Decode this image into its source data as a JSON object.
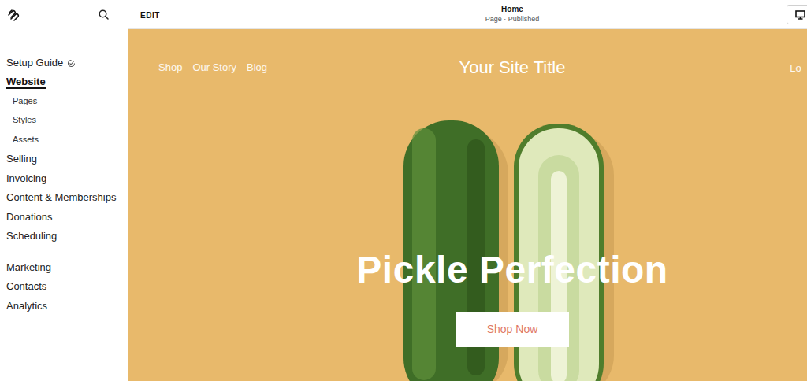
{
  "sidebar": {
    "groups": [
      {
        "items": [
          {
            "label": "Setup Guide",
            "kind": "section",
            "selected": false,
            "has_icon": true
          },
          {
            "label": "Website",
            "kind": "section",
            "selected": true,
            "has_icon": false
          },
          {
            "label": "Pages",
            "kind": "sub",
            "selected": false,
            "has_icon": false
          },
          {
            "label": "Styles",
            "kind": "sub",
            "selected": false,
            "has_icon": false
          },
          {
            "label": "Assets",
            "kind": "sub",
            "selected": false,
            "has_icon": false
          },
          {
            "label": "Selling",
            "kind": "section",
            "selected": false,
            "has_icon": false
          },
          {
            "label": "Invoicing",
            "kind": "section",
            "selected": false,
            "has_icon": false
          },
          {
            "label": "Content & Memberships",
            "kind": "section",
            "selected": false,
            "has_icon": false
          },
          {
            "label": "Donations",
            "kind": "section",
            "selected": false,
            "has_icon": false
          },
          {
            "label": "Scheduling",
            "kind": "section",
            "selected": false,
            "has_icon": false
          }
        ]
      },
      {
        "items": [
          {
            "label": "Marketing",
            "kind": "section",
            "selected": false,
            "has_icon": false
          },
          {
            "label": "Contacts",
            "kind": "section",
            "selected": false,
            "has_icon": false
          },
          {
            "label": "Analytics",
            "kind": "section",
            "selected": false,
            "has_icon": false
          }
        ]
      }
    ]
  },
  "toolbar": {
    "edit": "EDIT",
    "page_title": "Home",
    "page_status": "Page · Published"
  },
  "preview": {
    "nav_left": [
      {
        "label": "Shop"
      },
      {
        "label": "Our Story"
      },
      {
        "label": "Blog"
      }
    ],
    "site_title": "Your Site Title",
    "nav_right": "Lo",
    "heading": "Pickle Perfection",
    "button": "Shop Now"
  }
}
